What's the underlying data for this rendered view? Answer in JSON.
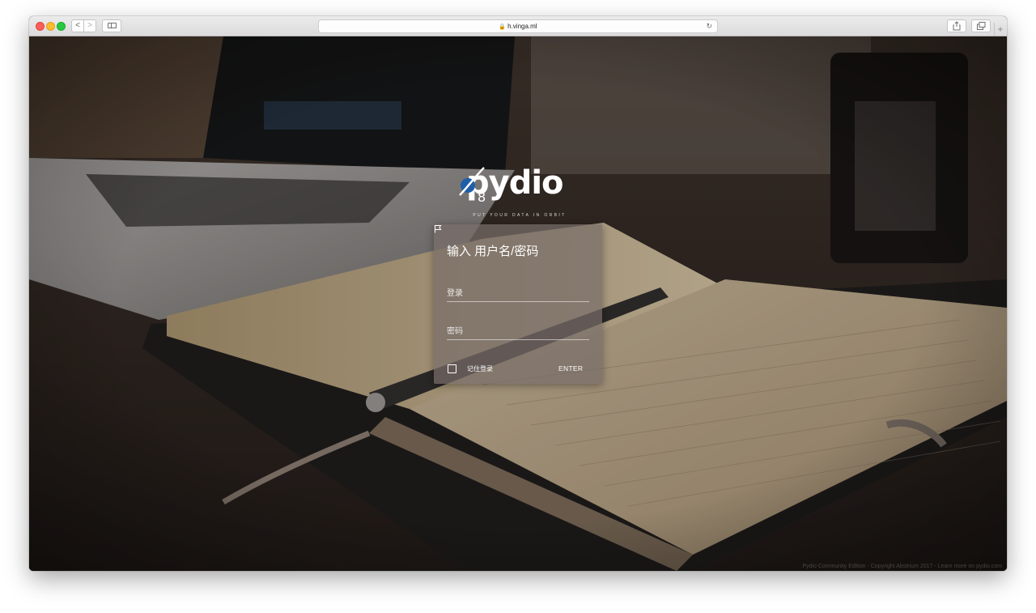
{
  "browser": {
    "url": "h.vinga.ml",
    "nav_back": "<",
    "nav_forward": ">",
    "new_tab": "+"
  },
  "logo": {
    "text": "pydio",
    "version": "8",
    "tagline": "PUT YOUR DATA IN ORBIT"
  },
  "login": {
    "title": "输入 用户名/密码",
    "username_placeholder": "登录",
    "password_placeholder": "密码",
    "remember_label": "记住登录",
    "enter_label": "ENTER"
  },
  "footer": {
    "copyright": "Pydio Community Edition - Copyright Abstrium 2017 - Learn more on pydio.com"
  },
  "colors": {
    "card_bg": "#786e69",
    "logo_accent": "#1f5fa8",
    "text": "#ffffff"
  }
}
